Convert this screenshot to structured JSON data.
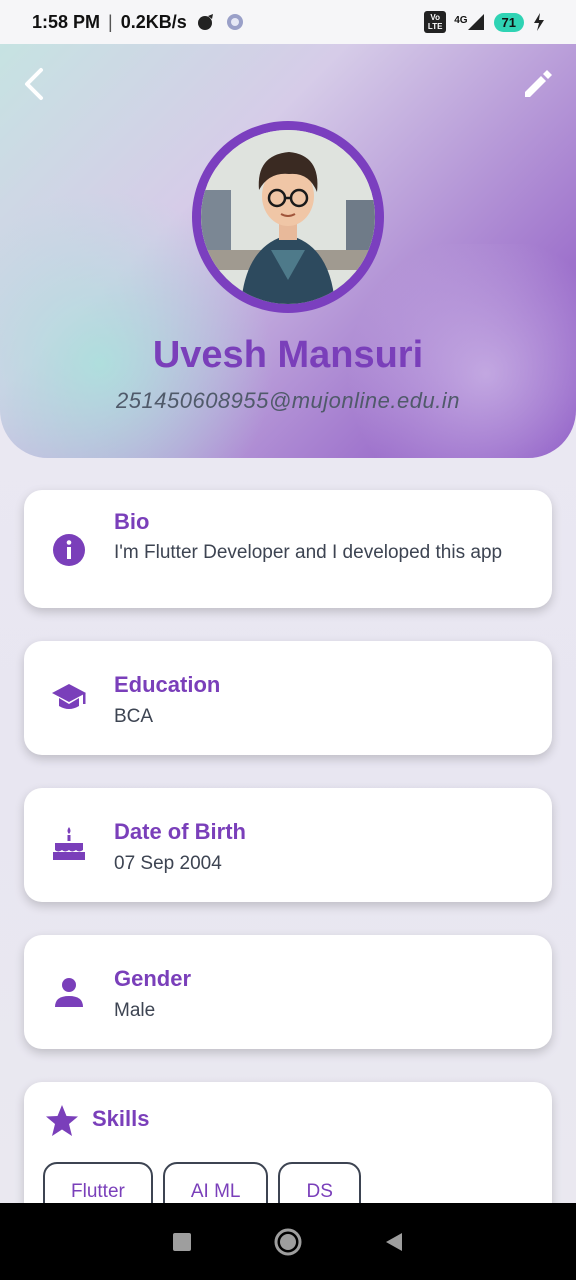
{
  "status": {
    "time": "1:58 PM",
    "speed": "0.2KB/s",
    "network": "4G",
    "volte": "Vo LTE",
    "battery": "71"
  },
  "profile": {
    "name": "Uvesh Mansuri",
    "email": "251450608955@mujonline.edu.in"
  },
  "cards": [
    {
      "title": "Bio",
      "value": "I'm Flutter Developer and I developed this app",
      "icon": "info-icon"
    },
    {
      "title": "Education",
      "value": "BCA",
      "icon": "graduation-cap-icon"
    },
    {
      "title": "Date of Birth",
      "value": "07 Sep 2004",
      "icon": "cake-icon"
    },
    {
      "title": "Gender",
      "value": "Male",
      "icon": "person-icon"
    }
  ],
  "skills": {
    "title": "Skills",
    "icon": "star-icon",
    "items": [
      "Flutter",
      "AI ML",
      "DS"
    ]
  },
  "colors": {
    "accent": "#7a3fba",
    "text": "#3d4452"
  }
}
